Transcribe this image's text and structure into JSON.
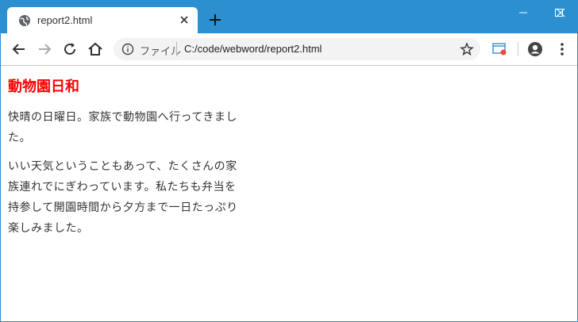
{
  "browser": {
    "tab_title": "report2.html",
    "omnibox_scheme_label": "ファイル",
    "omnibox_url": "C:/code/webword/report2.html"
  },
  "page": {
    "title": "動物園日和",
    "paragraphs": [
      "快晴の日曜日。家族で動物園へ行ってきました。",
      "いい天気ということもあって、たくさんの家族連れでにぎわっています。私たちも弁当を持参して開園時間から夕方まで一日たっぷり楽しみました。"
    ]
  },
  "colors": {
    "titlebar": "#2b8fd0",
    "page_title": "#ff0000"
  }
}
